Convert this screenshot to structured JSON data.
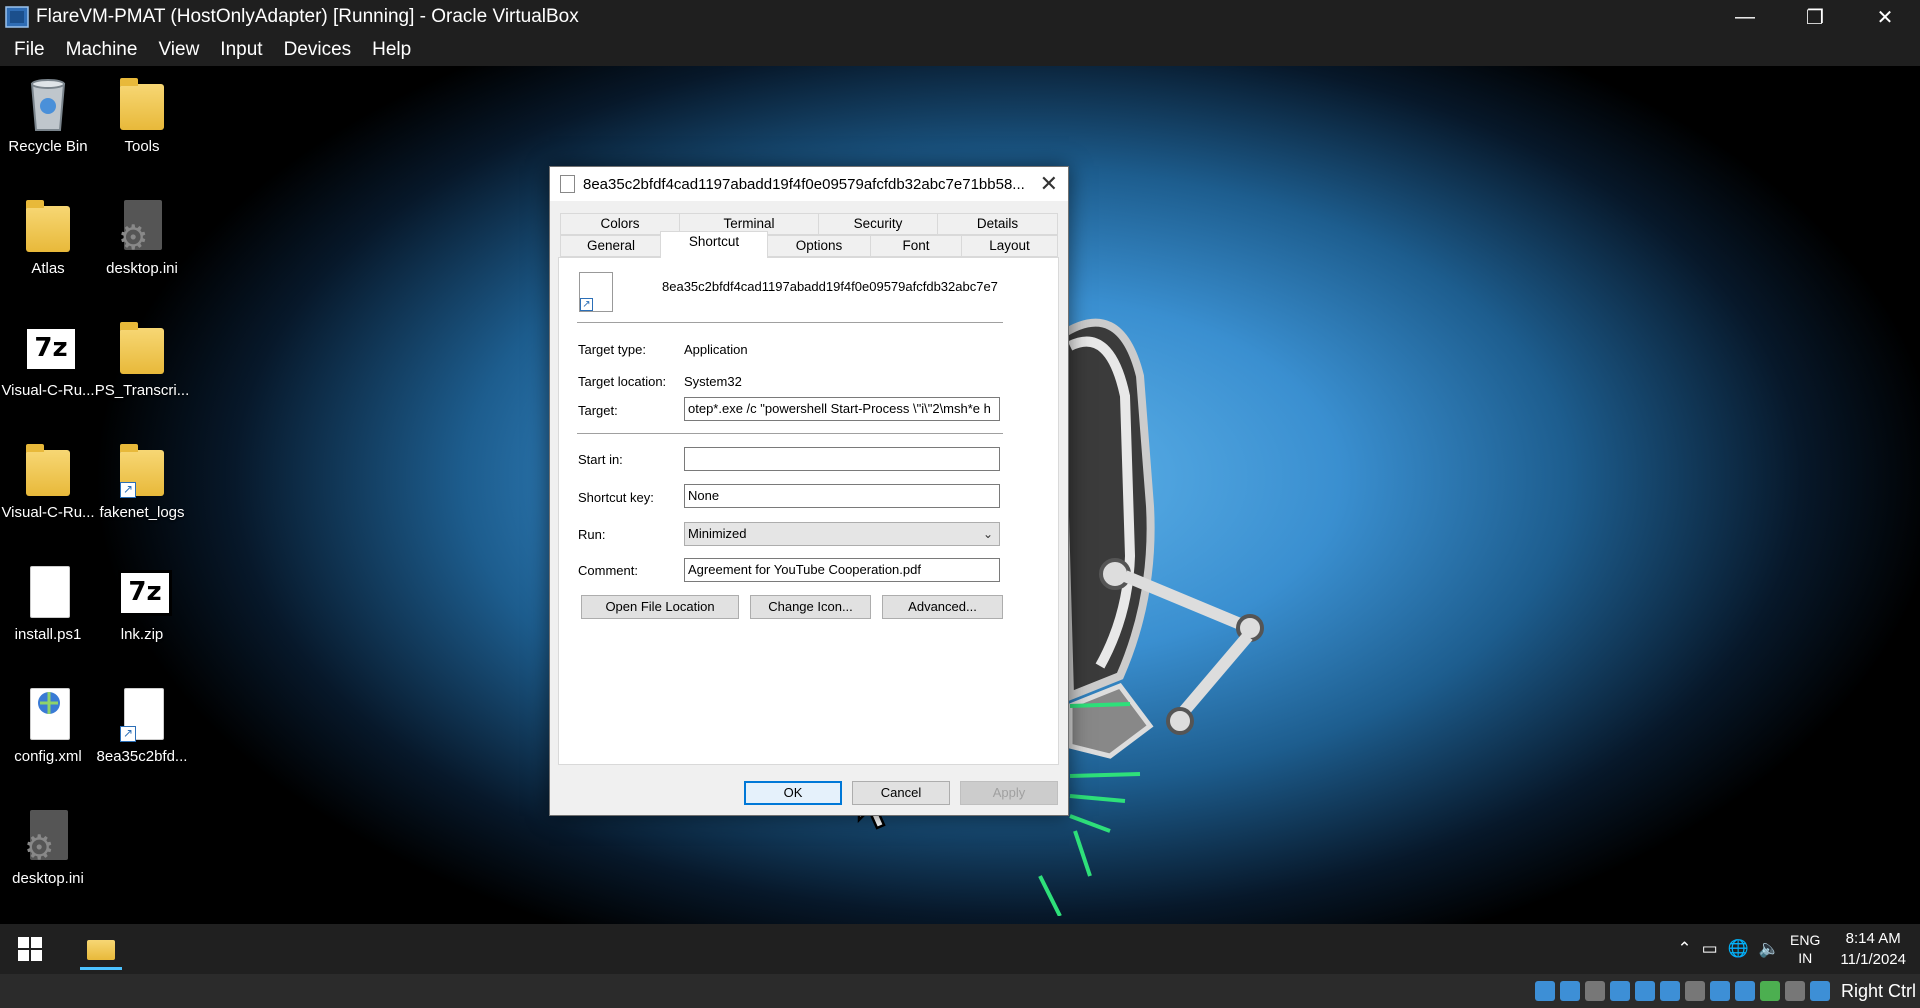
{
  "vbox": {
    "title": "FlareVM-PMAT (HostOnlyAdapter) [Running] - Oracle VirtualBox",
    "menu": [
      "File",
      "Machine",
      "View",
      "Input",
      "Devices",
      "Help"
    ],
    "host_key": "Right Ctrl"
  },
  "desktop": {
    "icons": [
      {
        "label": "Recycle Bin",
        "icon": "recycle-bin-icon"
      },
      {
        "label": "Tools",
        "icon": "folder-icon"
      },
      {
        "label": "Atlas",
        "icon": "folder-icon"
      },
      {
        "label": "desktop.ini",
        "icon": "settings-file-icon"
      },
      {
        "label": "Visual-C-Ru...",
        "icon": "7zip-icon"
      },
      {
        "label": "PS_Transcri...",
        "icon": "folder-icon"
      },
      {
        "label": "Visual-C-Ru...",
        "icon": "folder-icon"
      },
      {
        "label": "fakenet_logs",
        "icon": "folder-shortcut-icon"
      },
      {
        "label": "install.ps1",
        "icon": "file-icon"
      },
      {
        "label": "lnk.zip",
        "icon": "7zip-icon"
      },
      {
        "label": "config.xml",
        "icon": "xml-file-icon"
      },
      {
        "label": "8ea35c2bfd...",
        "icon": "shortcut-file-icon"
      },
      {
        "label": "desktop.ini",
        "icon": "settings-file-icon"
      }
    ]
  },
  "dialog": {
    "title": "8ea35c2bfdf4cad1197abadd19f4f0e09579afcfdb32abc7e71bb58...",
    "tabs_row1": [
      "Colors",
      "Terminal",
      "Security",
      "Details"
    ],
    "tabs_row2": [
      "General",
      "Shortcut",
      "Options",
      "Font",
      "Layout"
    ],
    "active_tab": "Shortcut",
    "file_name": "8ea35c2bfdf4cad1197abadd19f4f0e09579afcfdb32abc7e7",
    "target_type_label": "Target type:",
    "target_type_value": "Application",
    "target_location_label": "Target location:",
    "target_location_value": "System32",
    "target_label": "Target:",
    "target_value": "otep*.exe /c \"powershell Start-Process \\\"i\\\"2\\msh*e h",
    "start_in_label": "Start in:",
    "start_in_value": "",
    "shortcut_key_label": "Shortcut key:",
    "shortcut_key_value": "None",
    "run_label": "Run:",
    "run_value": "Minimized",
    "comment_label": "Comment:",
    "comment_value": "Agreement for YouTube Cooperation.pdf",
    "open_file_location": "Open File Location",
    "change_icon": "Change Icon...",
    "advanced": "Advanced...",
    "ok": "OK",
    "cancel": "Cancel",
    "apply": "Apply"
  },
  "taskbar": {
    "lang_line1": "ENG",
    "lang_line2": "IN",
    "time": "8:14 AM",
    "date": "11/1/2024"
  }
}
